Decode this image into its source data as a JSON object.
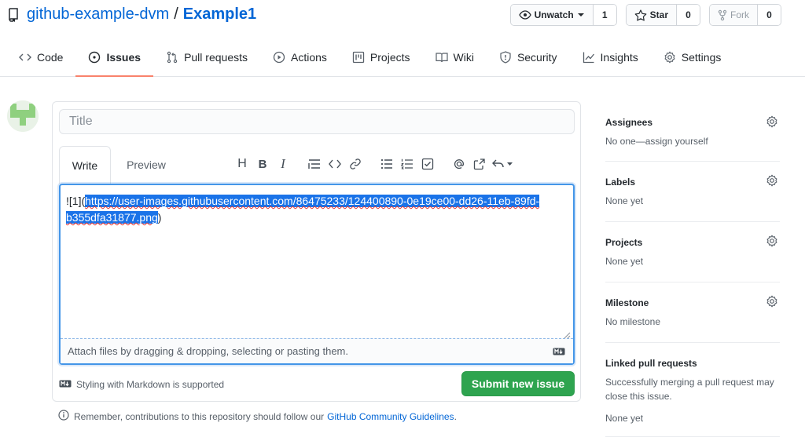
{
  "repo": {
    "owner": "github-example-dvm",
    "separator": "/",
    "name": "Example1"
  },
  "actions": {
    "watch": {
      "label": "Unwatch",
      "count": "1"
    },
    "star": {
      "label": "Star",
      "count": "0"
    },
    "fork": {
      "label": "Fork",
      "count": "0"
    }
  },
  "nav": {
    "items": [
      {
        "label": "Code",
        "icon": "code-icon"
      },
      {
        "label": "Issues",
        "icon": "issue-opened-icon",
        "active": true
      },
      {
        "label": "Pull requests",
        "icon": "git-pull-request-icon"
      },
      {
        "label": "Actions",
        "icon": "play-icon"
      },
      {
        "label": "Projects",
        "icon": "project-icon"
      },
      {
        "label": "Wiki",
        "icon": "book-icon"
      },
      {
        "label": "Security",
        "icon": "shield-icon"
      },
      {
        "label": "Insights",
        "icon": "graph-icon"
      },
      {
        "label": "Settings",
        "icon": "gear-icon"
      }
    ]
  },
  "form": {
    "title_placeholder": "Title",
    "tabs": {
      "write": "Write",
      "preview": "Preview"
    },
    "toolbar": {
      "heading": "H",
      "bold": "B",
      "italic": "I"
    },
    "body": {
      "prefix": "![1](",
      "selected_line1_a": "https://user-images.githubusercontent.com/86475233/124400890-0e19ce00-dd26-11eb-89fd-",
      "selected_line2": "b355dfa31877.png",
      "suffix": ")"
    },
    "attach_text": "Attach files by dragging & dropping, selecting or pasting them.",
    "markdown_note": "Styling with Markdown is supported",
    "submit_label": "Submit new issue"
  },
  "guidelines": {
    "text": "Remember, contributions to this repository should follow our",
    "link": "GitHub Community Guidelines",
    "end": "."
  },
  "sidebar": {
    "assignees": {
      "heading": "Assignees",
      "value": "No one—assign yourself"
    },
    "labels": {
      "heading": "Labels",
      "value": "None yet"
    },
    "projects": {
      "heading": "Projects",
      "value": "None yet"
    },
    "milestone": {
      "heading": "Milestone",
      "value": "No milestone"
    },
    "linked": {
      "heading": "Linked pull requests",
      "description": "Successfully merging a pull request may close this issue.",
      "value": "None yet"
    }
  },
  "colors": {
    "link": "#0366d6",
    "active_tab_underline": "#f9826c",
    "submit_green": "#2ea44f",
    "selection": "#1a73e8",
    "editor_focus": "#4496e8"
  }
}
